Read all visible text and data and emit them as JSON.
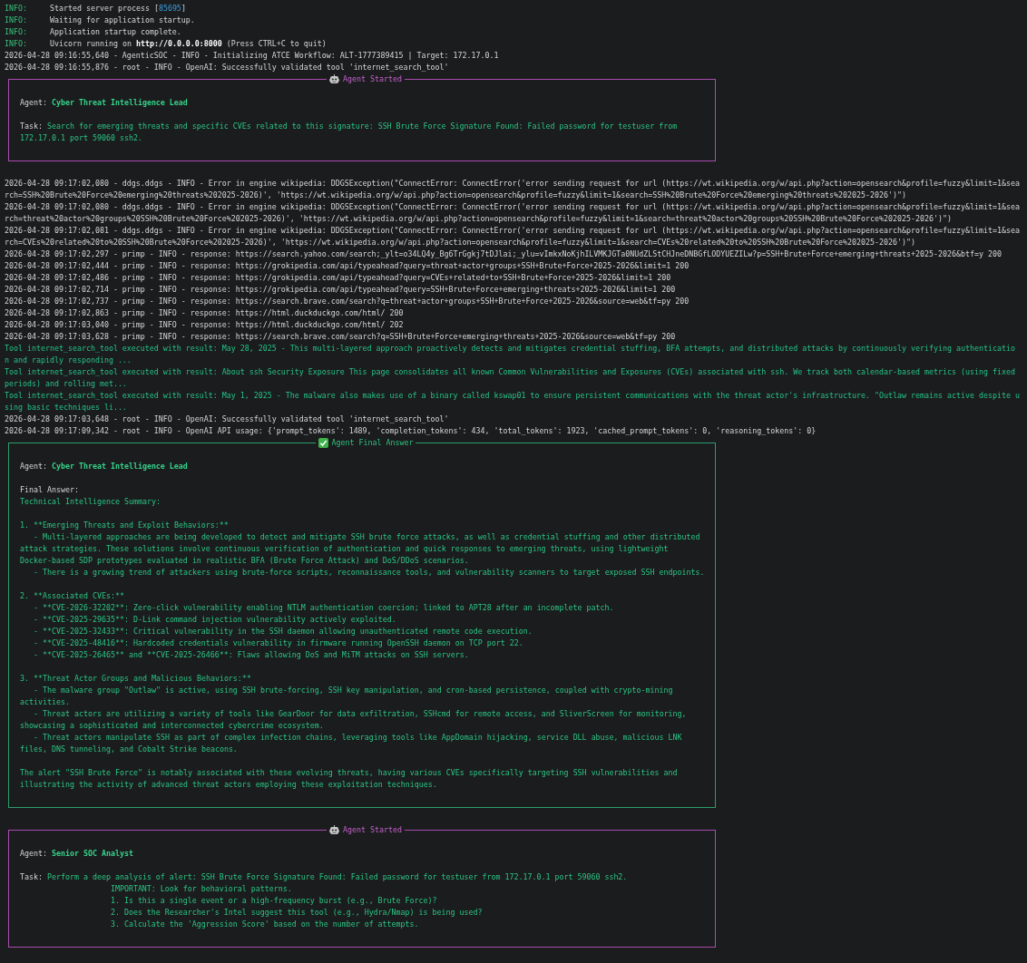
{
  "terminal": {
    "lines": [
      {
        "kind": "server",
        "level": "INFO:",
        "segments": [
          {
            "text": "Started server process ["
          },
          {
            "text": "85695",
            "kind": "number"
          },
          {
            "text": "]"
          }
        ]
      },
      {
        "kind": "server",
        "level": "INFO:",
        "segments": [
          {
            "text": "Waiting for application startup."
          }
        ]
      },
      {
        "kind": "server",
        "level": "INFO:",
        "segments": [
          {
            "text": "Application startup complete."
          }
        ]
      },
      {
        "kind": "server",
        "level": "INFO:",
        "segments": [
          {
            "text": "Uvicorn running on "
          },
          {
            "text": "http://0.0.0.0:8000",
            "kind": "bold"
          },
          {
            "text": " (Press CTRL+C to quit)"
          }
        ]
      },
      {
        "kind": "log",
        "text": "2026-04-28 09:16:55,640 - AgenticSOC - INFO - Initializing ATCE Workflow: ALT-1777389415 | Target: 172.17.0.1"
      },
      {
        "kind": "log",
        "text": "2026-04-28 09:16:55,876 - root - INFO - OpenAI: Successfully validated tool 'internet_search_tool'"
      },
      {
        "kind": "agent_started",
        "title": "Agent Started",
        "agent_label": "Agent:",
        "agent": "Cyber Threat Intelligence Lead",
        "task_label": "Task:",
        "task": "Search for emerging threats and specific CVEs related to this signature: SSH Brute Force Signature Found: Failed password for testuser from 172.17.0.1 port 59060 ssh2."
      },
      {
        "kind": "log",
        "text": "2026-04-28 09:17:02,080 - ddgs.ddgs - INFO - Error in engine wikipedia: DDGSException(\"ConnectError: ConnectError('error sending request for url (https://wt.wikipedia.org/w/api.php?action=opensearch&profile=fuzzy&limit=1&search=SSH%20Brute%20Force%20emerging%20threats%202025-2026)', 'https://wt.wikipedia.org/w/api.php?action=opensearch&profile=fuzzy&limit=1&search=SSH%20Brute%20Force%20emerging%20threats%202025-2026')\")"
      },
      {
        "kind": "log",
        "text": "2026-04-28 09:17:02,080 - ddgs.ddgs - INFO - Error in engine wikipedia: DDGSException(\"ConnectError: ConnectError('error sending request for url (https://wt.wikipedia.org/w/api.php?action=opensearch&profile=fuzzy&limit=1&search=threat%20actor%20groups%20SSH%20Brute%20Force%202025-2026)', 'https://wt.wikipedia.org/w/api.php?action=opensearch&profile=fuzzy&limit=1&search=threat%20actor%20groups%20SSH%20Brute%20Force%202025-2026')\")"
      },
      {
        "kind": "log",
        "text": "2026-04-28 09:17:02,081 - ddgs.ddgs - INFO - Error in engine wikipedia: DDGSException(\"ConnectError: ConnectError('error sending request for url (https://wt.wikipedia.org/w/api.php?action=opensearch&profile=fuzzy&limit=1&search=CVEs%20related%20to%20SSH%20Brute%20Force%202025-2026)', 'https://wt.wikipedia.org/w/api.php?action=opensearch&profile=fuzzy&limit=1&search=CVEs%20related%20to%20SSH%20Brute%20Force%202025-2026')\")"
      },
      {
        "kind": "log",
        "text": "2026-04-28 09:17:02,297 - primp - INFO - response: https://search.yahoo.com/search;_ylt=o34LQ4y_Bg6TrGgkj7tDJlai;_ylu=vImkxNoKjhILVMKJGTa0NUdZLStCHJneDNBGfLODYUEZILw?p=SSH+Brute+Force+emerging+threats+2025-2026&btf=y 200"
      },
      {
        "kind": "log",
        "text": "2026-04-28 09:17:02,444 - primp - INFO - response: https://grokipedia.com/api/typeahead?query=threat+actor+groups+SSH+Brute+Force+2025-2026&limit=1 200"
      },
      {
        "kind": "log",
        "text": "2026-04-28 09:17:02,486 - primp - INFO - response: https://grokipedia.com/api/typeahead?query=CVEs+related+to+SSH+Brute+Force+2025-2026&limit=1 200"
      },
      {
        "kind": "log",
        "text": "2026-04-28 09:17:02,714 - primp - INFO - response: https://grokipedia.com/api/typeahead?query=SSH+Brute+Force+emerging+threats+2025-2026&limit=1 200"
      },
      {
        "kind": "log",
        "text": "2026-04-28 09:17:02,737 - primp - INFO - response: https://search.brave.com/search?q=threat+actor+groups+SSH+Brute+Force+2025-2026&source=web&tf=py 200"
      },
      {
        "kind": "log",
        "text": "2026-04-28 09:17:02,863 - primp - INFO - response: https://html.duckduckgo.com/html/ 200"
      },
      {
        "kind": "log",
        "text": "2026-04-28 09:17:03,040 - primp - INFO - response: https://html.duckduckgo.com/html/ 202"
      },
      {
        "kind": "log",
        "text": "2026-04-28 09:17:03,628 - primp - INFO - response: https://search.brave.com/search?q=SSH+Brute+Force+emerging+threats+2025-2026&source=web&tf=py 200"
      },
      {
        "kind": "tool",
        "text": "Tool internet_search_tool executed with result: May 28, 2025 - This multi-layered approach proactively detects and mitigates credential stuffing, BFA attempts, and distributed attacks by continuously verifying authentication and rapidly responding ..."
      },
      {
        "kind": "tool",
        "text": "Tool internet_search_tool executed with result: About ssh Security Exposure This page consolidates all known Common Vulnerabilities and Exposures (CVEs) associated with ssh. We track both calendar-based metrics (using fixed periods) and rolling met..."
      },
      {
        "kind": "tool",
        "text": "Tool internet_search_tool executed with result: May 1, 2025 - The malware also makes use of a binary called kswap01 to ensure persistent communications with the threat actor's infrastructure. \"Outlaw remains active despite using basic techniques li..."
      },
      {
        "kind": "log",
        "text": "2026-04-28 09:17:03,648 - root - INFO - OpenAI: Successfully validated tool 'internet_search_tool'"
      },
      {
        "kind": "log",
        "text": "2026-04-28 09:17:09,342 - root - INFO - OpenAI API usage: {'prompt_tokens': 1489, 'completion_tokens': 434, 'total_tokens': 1923, 'cached_prompt_tokens': 0, 'reasoning_tokens': 0}"
      },
      {
        "kind": "final_answer",
        "title": "Agent Final Answer",
        "agent_label": "Agent:",
        "agent": "Cyber Threat Intelligence Lead",
        "answer_label": "Final Answer:",
        "answer": "Technical Intelligence Summary:\n\n1. **Emerging Threats and Exploit Behaviors:**\n   - Multi-layered approaches are being developed to detect and mitigate SSH brute force attacks, as well as credential stuffing and other distributed attack strategies. These solutions involve continuous verification of authentication and quick responses to emerging threats, using lightweight Docker-based SDP prototypes evaluated in realistic BFA (Brute Force Attack) and DoS/DDoS scenarios.\n   - There is a growing trend of attackers using brute-force scripts, reconnaissance tools, and vulnerability scanners to target exposed SSH endpoints.\n\n2. **Associated CVEs:**\n   - **CVE-2026-32202**: Zero-click vulnerability enabling NTLM authentication coercion; linked to APT28 after an incomplete patch.\n   - **CVE-2025-29635**: D-Link command injection vulnerability actively exploited.\n   - **CVE-2025-32433**: Critical vulnerability in the SSH daemon allowing unauthenticated remote code execution.\n   - **CVE-2025-48416**: Hardcoded credentials vulnerability in firmware running OpenSSH daemon on TCP port 22.\n   - **CVE-2025-26465** and **CVE-2025-26466**: Flaws allowing DoS and MiTM attacks on SSH servers.\n\n3. **Threat Actor Groups and Malicious Behaviors:**\n   - The malware group \"Outlaw\" is active, using SSH brute-forcing, SSH key manipulation, and cron-based persistence, coupled with crypto-mining activities.\n   - Threat actors are utilizing a variety of tools like GearDoor for data exfiltration, SSHcmd for remote access, and SliverScreen for monitoring, showcasing a sophisticated and interconnected cybercrime ecosystem.\n   - Threat actors manipulate SSH as part of complex infection chains, leveraging tools like AppDomain hijacking, service DLL abuse, malicious LNK files, DNS tunneling, and Cobalt Strike beacons.\n\nThe alert \"SSH Brute Force\" is notably associated with these evolving threats, having various CVEs specifically targeting SSH vulnerabilities and illustrating the activity of advanced threat actors employing these exploitation techniques."
      },
      {
        "kind": "agent_started",
        "title": "Agent Started",
        "agent_label": "Agent:",
        "agent": "Senior SOC Analyst",
        "task_label": "Task:",
        "task": "Perform a deep analysis of alert: SSH Brute Force Signature Found: Failed password for testuser from 172.17.0.1 port 59060 ssh2.\n                    IMPORTANT: Look for behavioral patterns.\n                    1. Is this a single event or a high-frequency burst (e.g., Brute Force)?\n                    2. Does the Researcher's Intel suggest this tool (e.g., Hydra/Nmap) is being used?\n                    3. Calculate the 'Aggression Score' based on the number of attempts."
      }
    ]
  }
}
